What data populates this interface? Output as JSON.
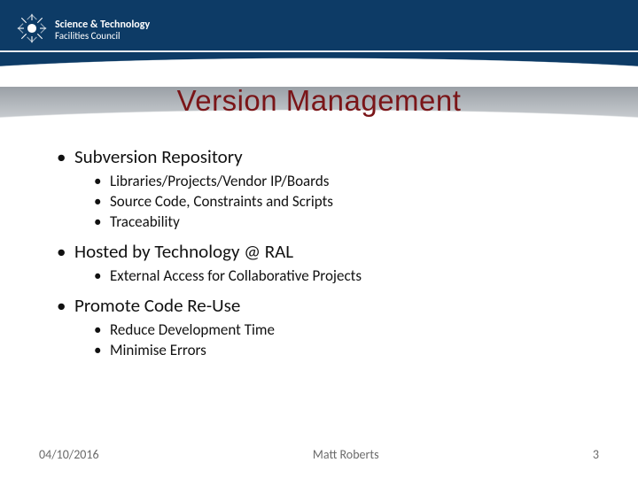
{
  "logo": {
    "line1": "Science & Technology",
    "line2": "Facilities Council"
  },
  "title": "Version Management",
  "bullets": [
    {
      "text": "Subversion Repository",
      "sub": [
        "Libraries/Projects/Vendor IP/Boards",
        "Source Code, Constraints and Scripts",
        "Traceability"
      ]
    },
    {
      "text": "Hosted by Technology @ RAL",
      "sub": [
        "External Access for Collaborative Projects"
      ]
    },
    {
      "text": "Promote Code Re-Use",
      "sub": [
        "Reduce Development Time",
        "Minimise Errors"
      ]
    }
  ],
  "footer": {
    "date": "04/10/2016",
    "author": "Matt Roberts",
    "page": "3"
  }
}
